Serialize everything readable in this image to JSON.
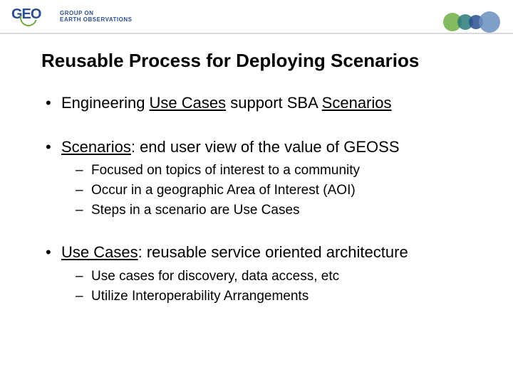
{
  "header": {
    "logo_letters": "GEO",
    "logo_line1": "GROUP ON",
    "logo_line2": "EARTH OBSERVATIONS"
  },
  "title": "Reusable Process for Deploying Scenarios",
  "bullets": {
    "b1_pre": "Engineering ",
    "b1_u1": "Use Cases",
    "b1_mid": " support SBA ",
    "b1_u2": "Scenarios",
    "b2_u": "Scenarios",
    "b2_rest": ": end user view of the value of GEOSS",
    "b2_sub1": "Focused on topics of interest to a community",
    "b2_sub2": "Occur in a geographic Area of Interest (AOI)",
    "b2_sub3": "Steps in a scenario are Use Cases",
    "b3_u": "Use Cases",
    "b3_rest": ": reusable service oriented architecture",
    "b3_sub1": "Use cases for discovery, data access, etc",
    "b3_sub2": "Utilize Interoperability Arrangements"
  }
}
